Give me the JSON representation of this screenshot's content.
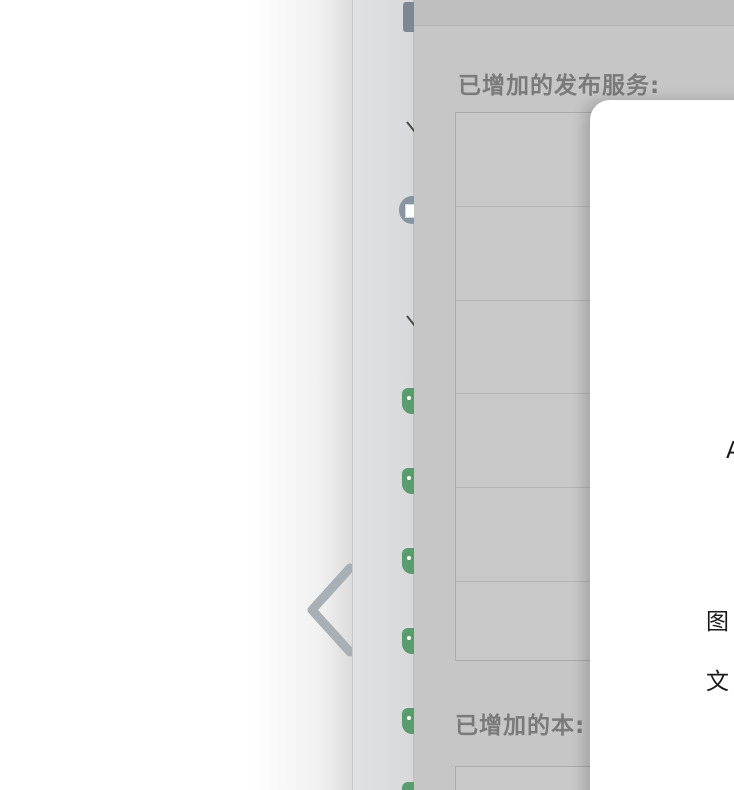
{
  "panel": {
    "published_services_label": "已增加的发布服务:",
    "local_label": "已增加的本:"
  },
  "dialog": {
    "letter_a": "A",
    "image_label": "图",
    "file_label": "文"
  },
  "colors": {
    "tag_green": "#5a9c6e",
    "panel_gray": "#c6c6c6",
    "dialog_white": "#ffffff"
  },
  "icons": {
    "sidebar_top": "app-icon",
    "sidebar_round": "calendar-icon",
    "sidebar_tags": "tag-icon",
    "sidebar_chevrons": "chevron-down-icon",
    "left_arrow": "back-arrow-icon"
  }
}
